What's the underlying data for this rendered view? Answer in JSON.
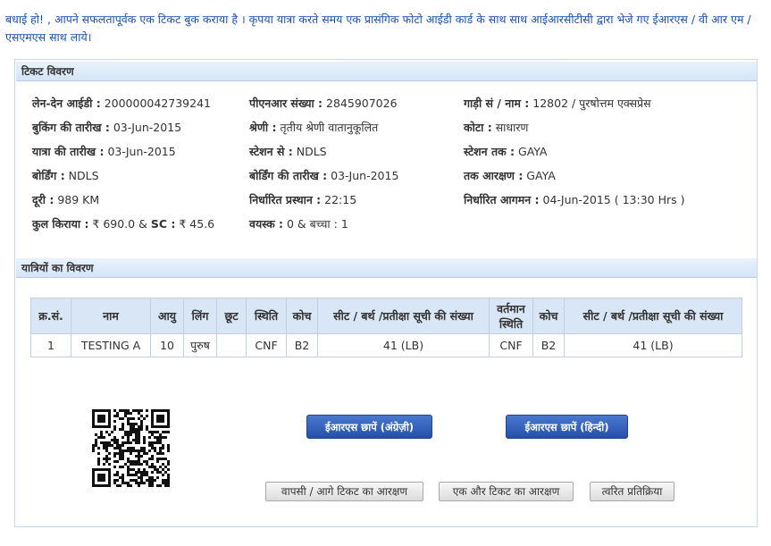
{
  "message": "बधाई हो! , आपने सफलतापूर्वक एक टिकट बुक कराया है । कृपया यात्रा करते समय एक प्रासंगिक फोटो आईडी कार्ड के साथ साथ आईआरसीटीसी द्वारा भेजे गए ईआरएस / वी आर एम / एसएमएस साथ लाये।",
  "ticket_section": {
    "title": "टिकट विवरण",
    "fields": [
      {
        "label": "लेन-देन आईडी :",
        "value": " 200000042739241"
      },
      {
        "label": "पीएनआर संख्या :",
        "value": " 2845907026"
      },
      {
        "label": "गाड़ी सं / नाम :",
        "value": " 12802 / पुरषोत्तम एक्सप्रेस"
      },
      {
        "label": "बुकिंग की तारीख :",
        "value": " 03-Jun-2015"
      },
      {
        "label": "श्रेणी :",
        "value": " तृतीय श्रेणी वातानुकूलित"
      },
      {
        "label": "कोटा :",
        "value": " साधारण"
      },
      {
        "label": "यात्रा की तारीख :",
        "value": " 03-Jun-2015"
      },
      {
        "label": "स्टेशन से :",
        "value": " NDLS"
      },
      {
        "label": "स्टेशन तक :",
        "value": " GAYA"
      },
      {
        "label": "बोर्डिंग :",
        "value": " NDLS"
      },
      {
        "label": "बोर्डिंग की तारीख :",
        "value": " 03-Jun-2015"
      },
      {
        "label": "तक आरक्षण :",
        "value": " GAYA"
      },
      {
        "label": "दूरी :",
        "value": " 989 KM"
      },
      {
        "label": "निर्धारित प्रस्थान :",
        "value": " 22:15"
      },
      {
        "label": "निर्धारित आगमन :",
        "value": " 04-Jun-2015 ( 13:30 Hrs )"
      },
      {
        "label": "वयस्क :",
        "value": " 0 & बच्चा : 1"
      }
    ],
    "fare": {
      "label": "कुल किराया :",
      "fare_value": " ₹ 690.0 & ",
      "sc_label": "SC :",
      "sc_value": " ₹ 45.6"
    }
  },
  "passenger_section": {
    "title": "यात्रियों का विवरण",
    "headers": [
      "क्र.सं.",
      "नाम",
      "आयु",
      "लिंग",
      "छूट",
      "स्थिति",
      "कोच",
      "सीट / बर्थ /प्रतीक्षा सूची की संख्या",
      "वर्तमान स्थिति",
      "कोच",
      "सीट / बर्थ /प्रतीक्षा सूची की संख्या"
    ],
    "rows": [
      [
        "1",
        "TESTING A",
        "10",
        "पुरुष",
        "",
        "CNF",
        "B2",
        "41 (LB)",
        "CNF",
        "B2",
        "41 (LB)"
      ]
    ]
  },
  "buttons": {
    "print_english": "ईआरएस छापें (अंग्रेज़ी)",
    "print_hindi": "ईआरएस छापें (हिन्दी)",
    "return_ticket": "वापसी / आगे टिकट का आरक्षण",
    "another_ticket": "एक और टिकट का आरक्षण",
    "feedback": "त्वरित प्रतिक्रिया"
  },
  "colors": {
    "message_text": "#1a4fb0",
    "header_bg": "#d4e4f7",
    "primary_button": "#2f5fbf"
  }
}
